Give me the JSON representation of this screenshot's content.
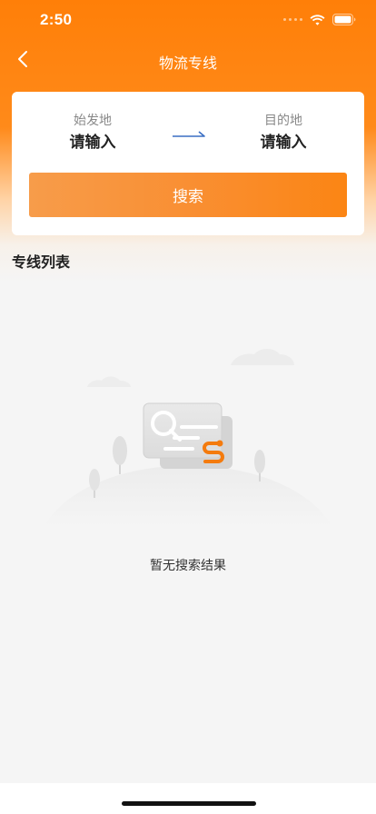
{
  "status_bar": {
    "time": "2:50"
  },
  "nav": {
    "title": "物流专线",
    "back_icon": "chevron-left-icon"
  },
  "search": {
    "origin_label": "始发地",
    "origin_value": "请输入",
    "destination_label": "目的地",
    "destination_value": "请输入",
    "button_label": "搜索"
  },
  "list": {
    "title": "专线列表",
    "empty_text": "暂无搜索结果"
  },
  "colors": {
    "brand_orange": "#ff7f08",
    "button_orange": "#fb8514",
    "arrow_blue": "#3a6fc4"
  }
}
